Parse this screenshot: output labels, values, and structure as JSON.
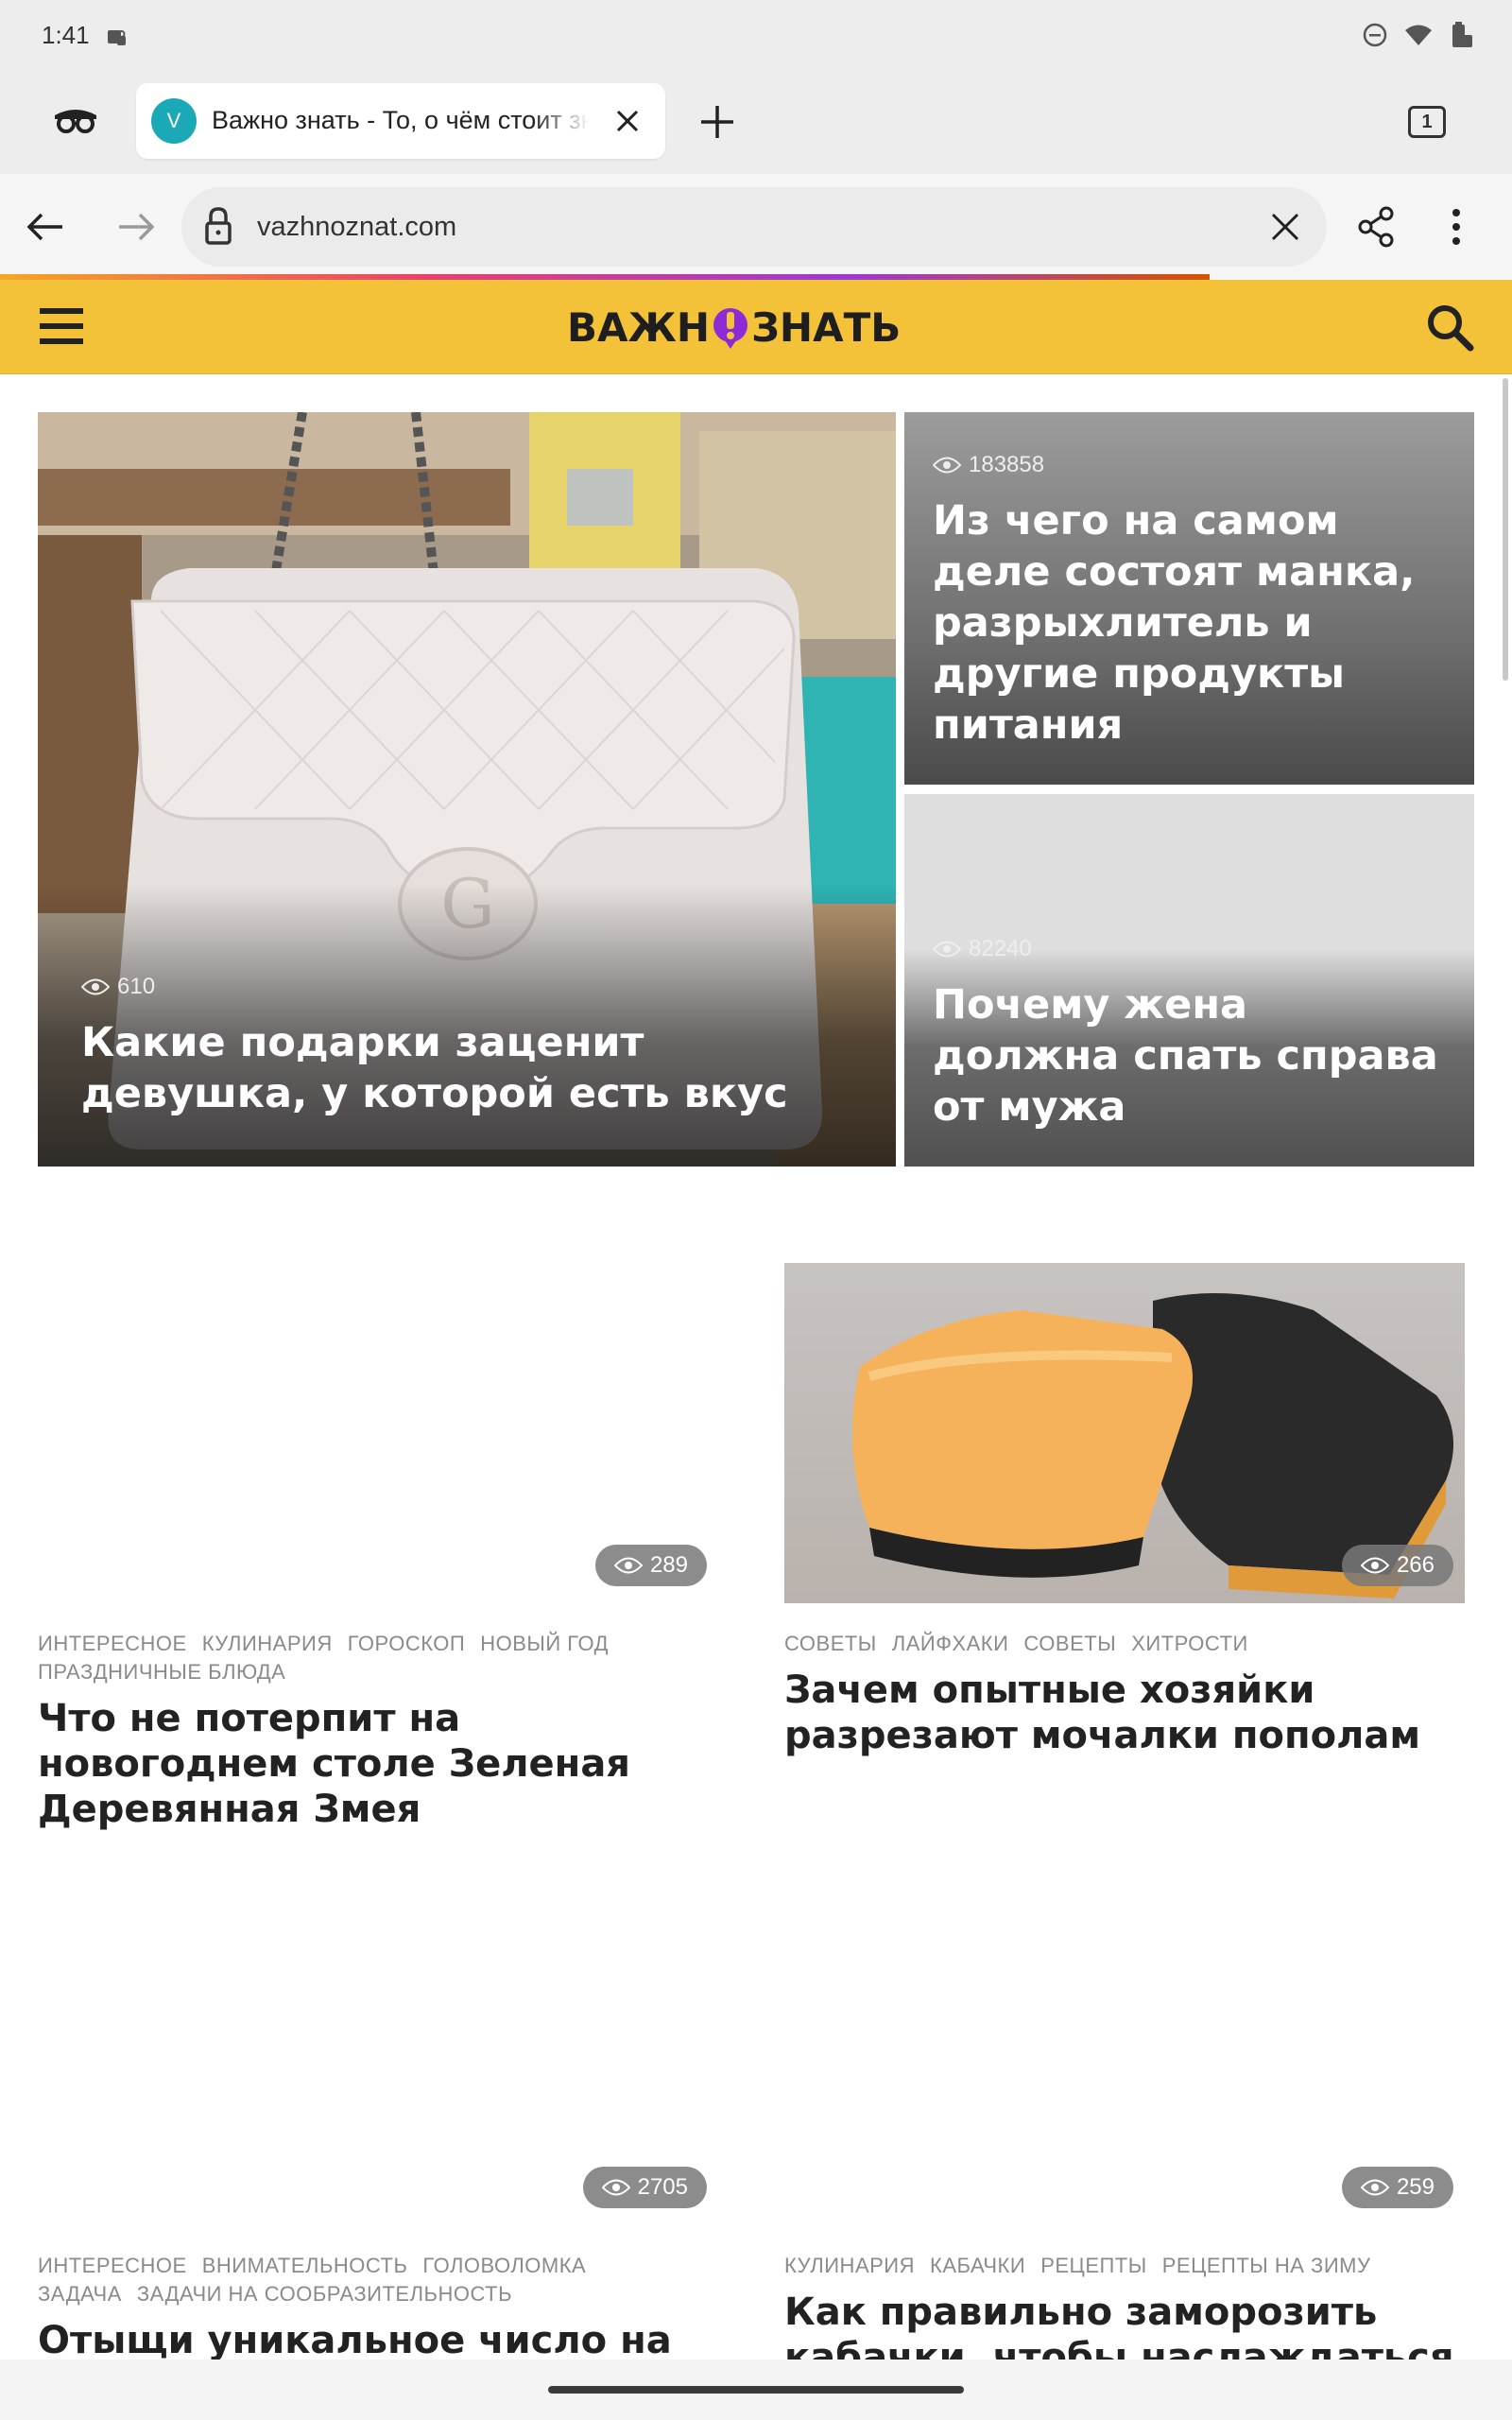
{
  "status_bar": {
    "time": "1:41"
  },
  "browser": {
    "tab": {
      "favicon_letter": "V",
      "title": "Важно знать - То, о чём стоит знать"
    },
    "tab_count": "1",
    "url": "vazhnoznat.com",
    "load_progress": 0.8
  },
  "site": {
    "logo_left": "ВАЖН",
    "logo_right": "ЗНАТЬ",
    "colors": {
      "header": "#f3c239",
      "logo_accent": "#8e2bd6"
    }
  },
  "hero": {
    "main": {
      "views": "610",
      "title": "Какие подарки заценит девушка, у которой есть вкус"
    },
    "side": [
      {
        "views": "183858",
        "title": "Из чего на самом деле состоят манка, разрыхлитель и другие продукты питания"
      },
      {
        "views": "82240",
        "title": "Почему жена должна спать справа от мужа"
      }
    ]
  },
  "cards": [
    {
      "views": "289",
      "tags": [
        "ИНТЕРЕСНОЕ",
        "КУЛИНАРИЯ",
        "ГОРОСКОП",
        "НОВЫЙ ГОД",
        "ПРАЗДНИЧНЫЕ БЛЮДА"
      ],
      "title": "Что не потерпит на новогоднем столе Зеленая Деревянная Змея"
    },
    {
      "views": "266",
      "tags": [
        "СОВЕТЫ",
        "ЛАЙФХАКИ",
        "СОВЕТЫ",
        "ХИТРОСТИ"
      ],
      "title": "Зачем опытные хозяйки разрезают мочалки пополам"
    },
    {
      "views": "2705",
      "tags": [
        "ИНТЕРЕСНОЕ",
        "ВНИМАТЕЛЬНОСТЬ",
        "ГОЛОВОЛОМКА",
        "ЗАДАЧА",
        "ЗАДАЧИ НА СООБРАЗИТЕЛЬНОСТЬ"
      ],
      "title": "Отыщи уникальное число на"
    },
    {
      "views": "259",
      "tags": [
        "КУЛИНАРИЯ",
        "КАБАЧКИ",
        "РЕЦЕПТЫ",
        "РЕЦЕПТЫ НА ЗИМУ"
      ],
      "title": "Как правильно заморозить кабачки, чтобы наслаждаться"
    }
  ]
}
